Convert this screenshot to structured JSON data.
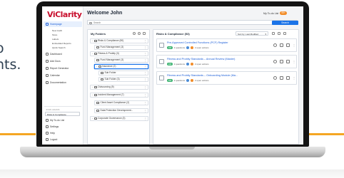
{
  "background": {
    "line1": "o",
    "line2": "nts.",
    "accent_color": "#f5a623"
  },
  "app": {
    "logo": "ViClarity",
    "logo_color": "#c8102e",
    "welcome": "Welcome John",
    "todo_label": "My To-do List",
    "todo_count": "99+",
    "search_placeholder": "Search",
    "search_button": "Search"
  },
  "sidebar": {
    "items": [
      {
        "label": "Homepage",
        "icon": "home-icon",
        "active": true
      },
      {
        "label": "Dashboard",
        "icon": "dashboard-icon"
      },
      {
        "label": "Add Docs",
        "icon": "add-docs-icon"
      },
      {
        "label": "Report Generator",
        "icon": "report-icon"
      },
      {
        "label": "Calendar",
        "icon": "calendar-icon"
      },
      {
        "label": "Documentation",
        "icon": "documentation-icon"
      }
    ],
    "subitems": [
      "New Audit",
      "Store",
      "Labels",
      "Embedded Reports",
      "Quick Search"
    ],
    "user_label": "JOHN ADAMS",
    "org_select": "Risks & Compliance",
    "bottom": [
      {
        "label": "My To-do List",
        "icon": "list-icon"
      },
      {
        "label": "Settings",
        "icon": "settings-icon"
      },
      {
        "label": "Help",
        "icon": "help-icon"
      },
      {
        "label": "Logout",
        "icon": "logout-icon"
      }
    ]
  },
  "folders": {
    "title": "My Folders",
    "items": [
      {
        "label": "Risks & Compliance (80)",
        "level": 0
      },
      {
        "label": "Fund Management (3)",
        "level": 1
      },
      {
        "label": "Fitness & Probity (3)",
        "level": 0
      },
      {
        "label": "Fund Management (3)",
        "level": 1
      },
      {
        "label": "Insurance (2)",
        "level": 1,
        "selected": true
      },
      {
        "label": "Sub Folder",
        "level": 2
      },
      {
        "label": "Sub Folder (3)",
        "level": 2
      },
      {
        "label": "Outsourcing (9)",
        "level": 0
      },
      {
        "label": "Incident Management (7)",
        "level": 0
      },
      {
        "label": "Client Asset Compliance (2)",
        "level": 1
      },
      {
        "label": "Data Protection Development...",
        "level": 1
      },
      {
        "label": "Corporate Governance (3)",
        "level": 0
      }
    ]
  },
  "right_panel": {
    "title": "Risks & Compliance (53)",
    "sort_label": "Sort by: Last Modified",
    "cards": [
      {
        "title": "Pre-Approved Controlled Functions (PCF) Register",
        "badge": "100",
        "stat1": "2 questions",
        "stat2": "2 open actions"
      },
      {
        "title": "Fitness and Probity Standards – Annual Review (Master)",
        "badge": "100",
        "stat1": "2 questions",
        "stat2": "2 open actions"
      },
      {
        "title": "Fitness and Probity Standards – Onboarding Module (Ma...",
        "badge": "100",
        "stat1": "2 questions",
        "stat2": "2 open actions"
      }
    ]
  }
}
